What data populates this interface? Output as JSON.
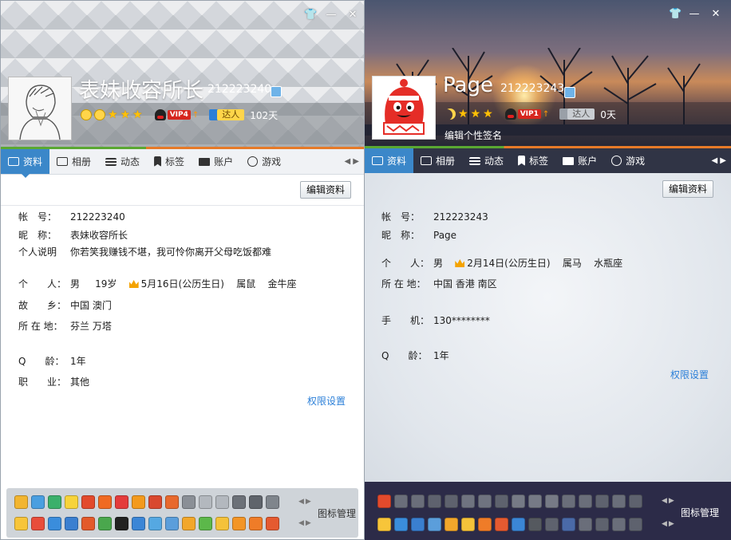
{
  "window_left": {
    "nickname": "表妹收容所长",
    "qq_number": "212223240",
    "vip_label": "VIP4",
    "daren_label": "达人",
    "active_days": "102天",
    "tabs": [
      "资料",
      "相册",
      "动态",
      "标签",
      "账户",
      "游戏"
    ],
    "edit_button": "编辑资料",
    "fields": {
      "account_label": "帐　号：",
      "account_value": "212223240",
      "nick_label": "昵　称：",
      "nick_value": "表妹收容所长",
      "desc_label": "个人说明",
      "desc_value": "你若笑我赚钱不堪，我可怜你离开父母吃饭都难",
      "personal_label": "个　　人：",
      "gender": "男",
      "age": "19岁",
      "birthday": "5月16日(公历生日)",
      "zodiac": "属鼠",
      "constellation": "金牛座",
      "hometown_label": "故　　乡：",
      "hometown_value": "中国 澳门",
      "location_label": "所 在 地：",
      "location_value": "芬兰 万塔",
      "qage_label": "Q　　龄：",
      "qage_value": "1年",
      "job_label": "职　　业：",
      "job_value": "其他"
    },
    "permission_link": "权限设置",
    "icon_manager": "图标管理",
    "colors": {
      "tab_active": "#3b87c9",
      "link": "#2b7fd8",
      "vip": "#d7261e"
    }
  },
  "window_right": {
    "nickname": "Page",
    "qq_number": "212223243",
    "vip_label": "VIP1",
    "daren_label": "达人",
    "active_days": "0天",
    "signature_prompt": "编辑个性签名",
    "tabs": [
      "资料",
      "相册",
      "动态",
      "标签",
      "账户",
      "游戏"
    ],
    "edit_button": "编辑资料",
    "fields": {
      "account_label": "帐　号：",
      "account_value": "212223243",
      "nick_label": "昵　称：",
      "nick_value": "Page",
      "personal_label": "个　　人：",
      "gender": "男",
      "birthday": "2月14日(公历生日)",
      "zodiac": "属马",
      "constellation": "水瓶座",
      "location_label": "所 在 地：",
      "location_value": "中国 香港 南区",
      "phone_label": "手　　机：",
      "phone_value": "130********",
      "qage_label": "Q　　龄：",
      "qage_value": "1年"
    },
    "permission_link": "权限设置",
    "icon_manager": "图标管理"
  }
}
